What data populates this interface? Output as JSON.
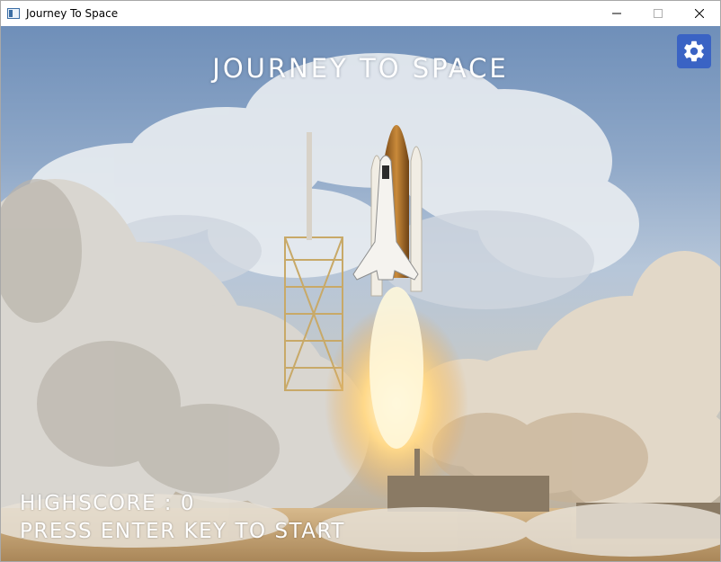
{
  "window": {
    "title": "Journey To Space",
    "icon": "app-window-icon",
    "controls": [
      "minimize-icon",
      "maximize-icon",
      "close-icon"
    ]
  },
  "game": {
    "title": "JOURNEY TO SPACE",
    "settings_icon": "gear-icon",
    "highscore_label": "HIGHSCORE :",
    "highscore_value": "0",
    "prompt": "PRESS ENTER KEY TO START",
    "background": "space-shuttle-launch-photo"
  },
  "colors": {
    "settings_button": "#3a63c4",
    "text": "#ffffff",
    "titlebar": "#ffffff"
  }
}
